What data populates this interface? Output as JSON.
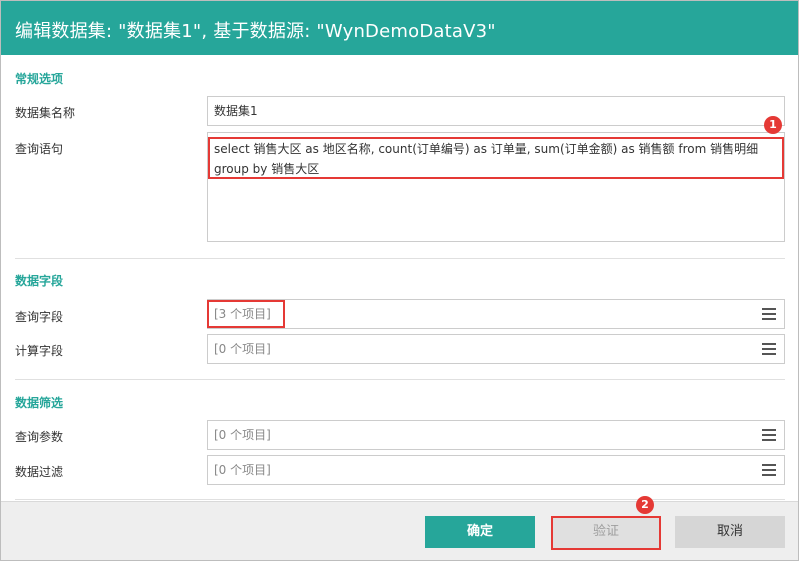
{
  "dialog": {
    "title": "编辑数据集: \"数据集1\", 基于数据源: \"WynDemoDataV3\""
  },
  "general": {
    "section_title": "常规选项",
    "name_label": "数据集名称",
    "name_value": "数据集1",
    "query_label": "查询语句",
    "query_value": "select 销售大区 as 地区名称, count(订单编号) as 订单量, sum(订单金额) as 销售额 from 销售明细 group by 销售大区"
  },
  "fields": {
    "section_title": "数据字段",
    "query_fields_label": "查询字段",
    "query_fields_value": "[3 个项目]",
    "calc_fields_label": "计算字段",
    "calc_fields_value": "[0 个项目]"
  },
  "filters": {
    "section_title": "数据筛选",
    "params_label": "查询参数",
    "params_value": "[0 个项目]",
    "filter_label": "数据过滤",
    "filter_value": "[0 个项目]"
  },
  "annotations": {
    "badge1": "1",
    "badge2": "2",
    "highlight_color": "#e53935"
  },
  "footer": {
    "ok_label": "确定",
    "verify_label": "验证",
    "cancel_label": "取消"
  },
  "theme": {
    "accent": "#26a69a"
  }
}
